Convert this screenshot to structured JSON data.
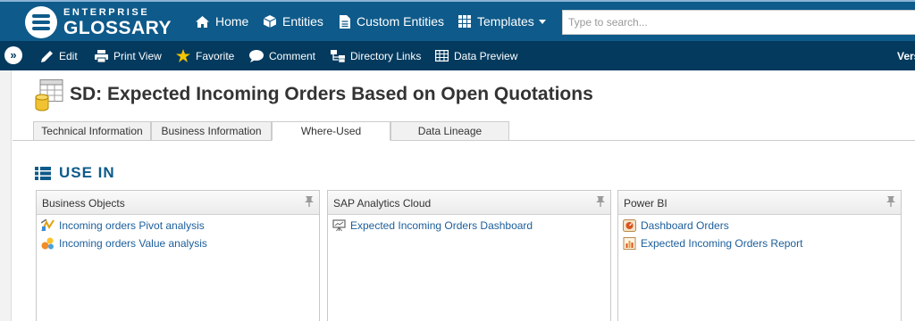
{
  "app": {
    "logo_line1": "ENTERPRISE",
    "logo_line2": "GLOSSARY"
  },
  "nav": {
    "home": "Home",
    "entities": "Entities",
    "custom_entities": "Custom Entities",
    "templates": "Templates"
  },
  "search": {
    "placeholder": "Type to search..."
  },
  "toolbar": {
    "toggle": "»",
    "edit": "Edit",
    "print_view": "Print View",
    "favorite": "Favorite",
    "comment": "Comment",
    "directory_links": "Directory Links",
    "data_preview": "Data Preview",
    "version_cut": "Vers"
  },
  "page": {
    "title": "SD: Expected Incoming Orders Based on Open Quotations"
  },
  "tabs": [
    {
      "label": "Technical Information"
    },
    {
      "label": "Business Information"
    },
    {
      "label": "Where-Used"
    },
    {
      "label": "Data Lineage"
    }
  ],
  "active_tab": "Where-Used",
  "section": {
    "title": "USE IN"
  },
  "panels": [
    {
      "title": "Business Objects",
      "items": [
        {
          "label": "Incoming orders Pivot analysis",
          "icon": "pivot-analysis-icon"
        },
        {
          "label": "Incoming orders Value analysis",
          "icon": "value-analysis-icon"
        }
      ]
    },
    {
      "title": "SAP Analytics Cloud",
      "items": [
        {
          "label": "Expected Incoming Orders Dashboard",
          "icon": "presentation-icon"
        }
      ]
    },
    {
      "title": "Power BI",
      "items": [
        {
          "label": "Dashboard Orders",
          "icon": "dashboard-icon"
        },
        {
          "label": "Expected Incoming Orders Report",
          "icon": "report-icon"
        }
      ]
    }
  ],
  "colors": {
    "topbar": "#0e5a8a",
    "toolbar": "#033a5e",
    "link": "#1b5e9b",
    "section_title": "#0e5a8a"
  }
}
